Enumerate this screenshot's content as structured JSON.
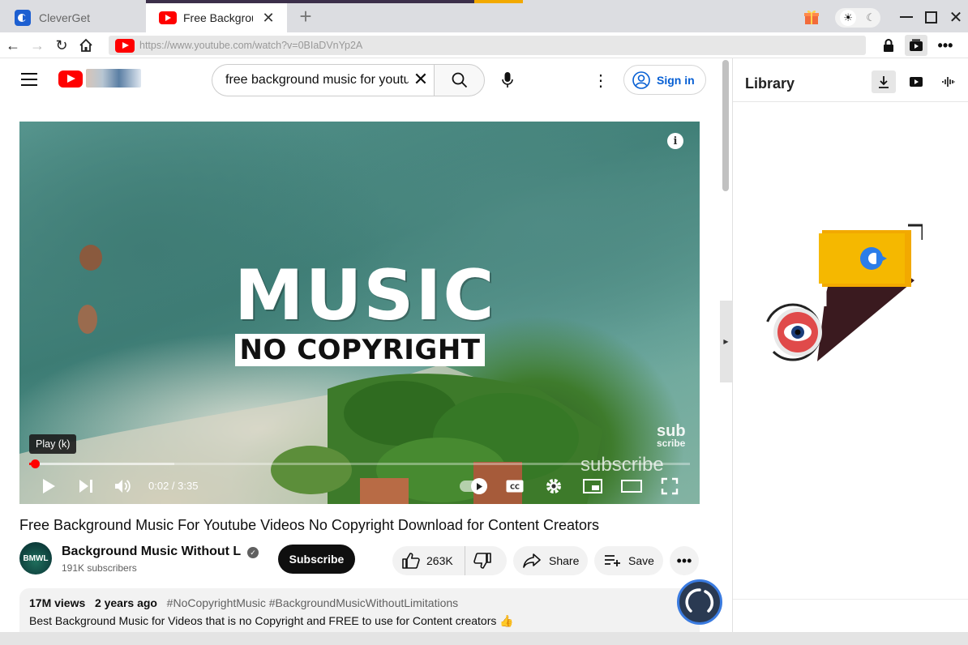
{
  "tabs": [
    {
      "label": "CleverGet",
      "active": false
    },
    {
      "label": "Free Background Music",
      "active": true
    }
  ],
  "address_bar": {
    "url": "https://www.youtube.com/watch?v=0BIaDVnYp2A"
  },
  "youtube": {
    "search": {
      "query": "free background music for youtube"
    },
    "sign_in_label": "Sign in",
    "player": {
      "art_line1": "MUSIC",
      "art_line2": "NO COPYRIGHT",
      "watermark_sub": "sub",
      "watermark_scribe": "scribe",
      "watermark_subscribe": "subscribe",
      "tooltip": "Play (k)",
      "time": "0:02 / 3:35",
      "progress_fraction": 0.009,
      "buffered_fraction": 0.22
    },
    "video": {
      "title": "Free Background Music For Youtube Videos No Copyright Download for Content Creators",
      "channel_name": "Background Music Without Limitations",
      "channel_avatar_text": "BMWL",
      "subscribers": "191K subscribers",
      "subscribe_label": "Subscribe",
      "likes": "263K",
      "share_label": "Share",
      "save_label": "Save"
    },
    "description": {
      "views": "17M views",
      "age": "2 years ago",
      "tags": "#NoCopyrightMusic #BackgroundMusicWithoutLimitations",
      "text": "Best Background Music for Videos that is no Copyright and FREE to use for Content creators 👍"
    }
  },
  "library_panel": {
    "title": "Library"
  },
  "colors": {
    "youtube_red": "#ff0000",
    "link_blue": "#065fd4",
    "cleverget_yellow": "#f5b800",
    "cleverget_blue": "#2b7de9"
  }
}
